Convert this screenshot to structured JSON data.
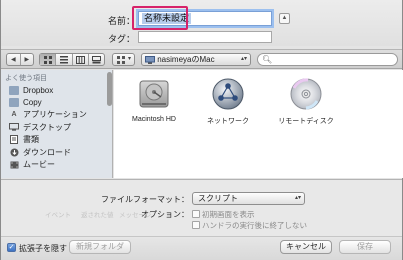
{
  "save": {
    "name_label": "名前：",
    "name_value": "名称未設定",
    "tag_label": "タグ：",
    "tag_value": ""
  },
  "toolbar": {
    "nav_back": "◀",
    "nav_forward": "▶",
    "location": "nasimeyaのMac",
    "search_placeholder": "",
    "view_modes": [
      "icon-view",
      "list-view",
      "column-view",
      "coverflow-view"
    ],
    "arrange_icon": "grid-icon"
  },
  "sidebar": {
    "section_title": "よく使う項目",
    "items": [
      {
        "label": "Dropbox",
        "icon": "folder-icon"
      },
      {
        "label": "Copy",
        "icon": "folder-icon"
      },
      {
        "label": "アプリケーション",
        "icon": "apps-icon"
      },
      {
        "label": "デスクトップ",
        "icon": "desktop-icon"
      },
      {
        "label": "書類",
        "icon": "document-icon"
      },
      {
        "label": "ダウンロード",
        "icon": "download-icon"
      },
      {
        "label": "ムービー",
        "icon": "movie-icon"
      }
    ]
  },
  "volumes": [
    {
      "label": "Macintosh HD",
      "icon": "hard-disk-icon"
    },
    {
      "label": "ネットワーク",
      "icon": "network-icon"
    },
    {
      "label": "リモートディスク",
      "icon": "remote-disc-icon"
    }
  ],
  "options": {
    "format_label": "ファイルフォーマット：",
    "format_value": "スクリプト",
    "option_label": "オプション：",
    "checkboxes": [
      {
        "label": "初期画面を表示",
        "checked": false
      },
      {
        "label": "ハンドラの実行後に終了しない",
        "checked": false
      }
    ],
    "ghost": [
      "イベント",
      "返された値",
      "メッセージ"
    ]
  },
  "footer": {
    "hide_ext_label": "拡張子を隠す",
    "hide_ext_checked": true,
    "new_folder_label": "新規フォルダ",
    "cancel_label": "キャンセル",
    "save_label": "保存"
  },
  "colors": {
    "highlight": "#d6236a",
    "selection": "#b7cdec"
  }
}
